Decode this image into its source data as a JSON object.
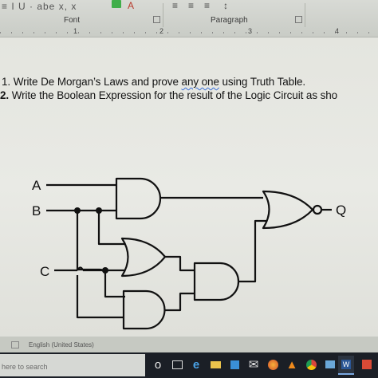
{
  "ribbon": {
    "font_group_label": "Font",
    "paragraph_group_label": "Paragraph",
    "buttons_text": "≡ I U · abe x, x",
    "ruler_numbers": [
      "1",
      "2",
      "3",
      "4"
    ]
  },
  "questions": [
    {
      "number": "1.",
      "text_before": "Write De Morgan’s Laws and prove ",
      "underlined": "any one",
      "text_after": " using Truth Table."
    },
    {
      "number": "2.",
      "text": "Write the Boolean Expression for the result of the Logic Circuit as sho"
    }
  ],
  "circuit": {
    "inputs": [
      "A",
      "B",
      "C"
    ],
    "output": "Q",
    "gates": [
      "and",
      "or",
      "and",
      "and",
      "or"
    ]
  },
  "statusbar": {
    "language": "English (United States)"
  },
  "taskbar": {
    "search_placeholder": "here to search"
  },
  "colors": {
    "spell_underline": "#3a6fd8",
    "ink": "#111111",
    "taskbar": "#1b1f26"
  }
}
